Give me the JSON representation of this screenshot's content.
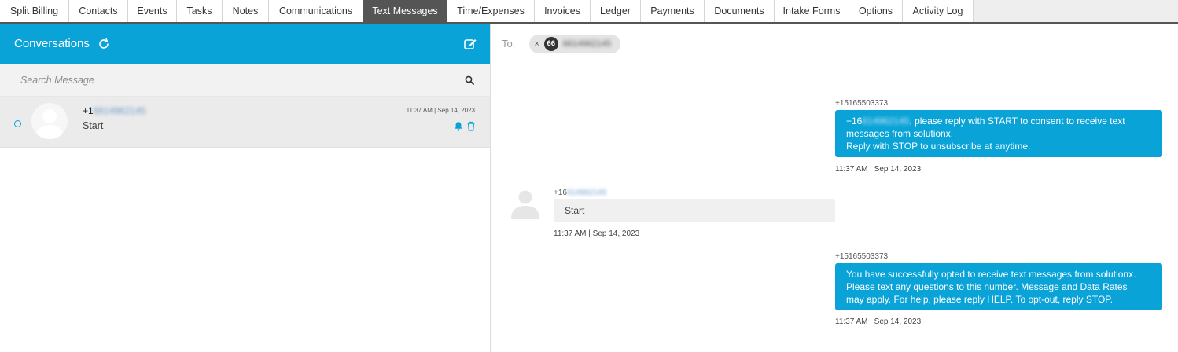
{
  "tabs": [
    {
      "label": "Split Billing",
      "active": false
    },
    {
      "label": "Contacts",
      "active": false
    },
    {
      "label": "Events",
      "active": false
    },
    {
      "label": "Tasks",
      "active": false
    },
    {
      "label": "Notes",
      "active": false
    },
    {
      "label": "Communications",
      "active": false
    },
    {
      "label": "Text Messages",
      "active": true
    },
    {
      "label": "Time/Expenses",
      "active": false
    },
    {
      "label": "Invoices",
      "active": false
    },
    {
      "label": "Ledger",
      "active": false
    },
    {
      "label": "Payments",
      "active": false
    },
    {
      "label": "Documents",
      "active": false
    },
    {
      "label": "Intake Forms",
      "active": false
    },
    {
      "label": "Options",
      "active": false
    },
    {
      "label": "Activity Log",
      "active": false
    }
  ],
  "conversations": {
    "title": "Conversations",
    "refresh_icon": "refresh-icon",
    "compose_icon": "compose-icon",
    "search": {
      "placeholder": "Search Message",
      "value": ""
    },
    "items": [
      {
        "name_prefix": "+1",
        "name_redacted": "6614962145",
        "preview": "Start",
        "time": "11:37 AM | Sep 14, 2023",
        "unread": true
      }
    ]
  },
  "thread": {
    "to_label": "To:",
    "recipient": {
      "badge": "66",
      "number_redacted": "6614962145",
      "remove": "×"
    },
    "messages": [
      {
        "direction": "outgoing",
        "sender": "+15165503373",
        "text_prefix": "+16",
        "text_redacted": "614962145",
        "lines": [
          ", please reply with START to consent to receive text",
          "messages from solutionx.",
          "Reply with STOP to unsubscribe at anytime."
        ],
        "time": "11:37 AM | Sep 14, 2023"
      },
      {
        "direction": "incoming",
        "sender_prefix": "+16",
        "sender_redacted": "614962145",
        "text": "Start",
        "time": "11:37 AM | Sep 14, 2023"
      },
      {
        "direction": "outgoing",
        "sender": "+15165503373",
        "lines": [
          "You have successfully opted to receive text messages from solutionx.",
          "Please text any questions to this number. Message and Data Rates",
          "may apply. For help, please reply HELP. To opt-out, reply STOP."
        ],
        "time": "11:37 AM | Sep 14, 2023"
      }
    ]
  },
  "colors": {
    "accent": "#0aa3d8",
    "active_tab": "#555555"
  }
}
